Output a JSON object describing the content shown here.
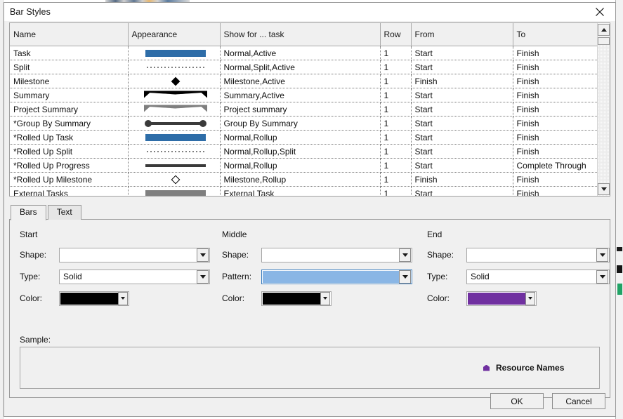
{
  "dialog": {
    "title": "Bar Styles",
    "close_icon": "close-icon"
  },
  "grid": {
    "columns": [
      "Name",
      "Appearance",
      "Show for ... task",
      "Row",
      "From",
      "To"
    ],
    "rows": [
      {
        "name": "Task",
        "appearance": "bar-blue",
        "show_for": "Normal,Active",
        "row": "1",
        "from": "Start",
        "to": "Finish"
      },
      {
        "name": "Split",
        "appearance": "dotted-line",
        "show_for": "Normal,Split,Active",
        "row": "1",
        "from": "Start",
        "to": "Finish"
      },
      {
        "name": "Milestone",
        "appearance": "diamond-solid",
        "show_for": "Milestone,Active",
        "row": "1",
        "from": "Finish",
        "to": "Finish"
      },
      {
        "name": "Summary",
        "appearance": "summary-black",
        "show_for": "Summary,Active",
        "row": "1",
        "from": "Start",
        "to": "Finish"
      },
      {
        "name": "Project Summary",
        "appearance": "summary-gray",
        "show_for": "Project summary",
        "row": "1",
        "from": "Start",
        "to": "Finish"
      },
      {
        "name": "*Group By Summary",
        "appearance": "groupby-bar",
        "show_for": "Group By Summary",
        "row": "1",
        "from": "Start",
        "to": "Finish"
      },
      {
        "name": "*Rolled Up Task",
        "appearance": "bar-blue",
        "show_for": "Normal,Rollup",
        "row": "1",
        "from": "Start",
        "to": "Finish"
      },
      {
        "name": "*Rolled Up Split",
        "appearance": "dotted-line",
        "show_for": "Normal,Rollup,Split",
        "row": "1",
        "from": "Start",
        "to": "Finish"
      },
      {
        "name": "*Rolled Up Progress",
        "appearance": "line-thick",
        "show_for": "Normal,Rollup",
        "row": "1",
        "from": "Start",
        "to": "Complete Through"
      },
      {
        "name": "*Rolled Up Milestone",
        "appearance": "diamond-hollow",
        "show_for": "Milestone,Rollup",
        "row": "1",
        "from": "Finish",
        "to": "Finish"
      },
      {
        "name": "External Tasks",
        "appearance": "bar-gray",
        "show_for": "External Task",
        "row": "1",
        "from": "Start",
        "to": "Finish"
      }
    ],
    "scrollbar": {
      "up_icon": "scroll-up-arrow-icon",
      "down_icon": "scroll-down-arrow-icon"
    }
  },
  "tabs": [
    {
      "label": "Bars",
      "active": true
    },
    {
      "label": "Text",
      "active": false
    }
  ],
  "bars_tab": {
    "start": {
      "title": "Start",
      "shape_label": "Shape:",
      "shape_value": "",
      "type_label": "Type:",
      "type_value": "Solid",
      "color_label": "Color:",
      "color_value": "#000000"
    },
    "middle": {
      "title": "Middle",
      "shape_label": "Shape:",
      "shape_value": "",
      "pattern_label": "Pattern:",
      "pattern_value": "",
      "pattern_color": "#8AB6E5",
      "color_label": "Color:",
      "color_value": "#000000"
    },
    "end": {
      "title": "End",
      "shape_label": "Shape:",
      "shape_value": "",
      "shape_glyph": "pentagon-up",
      "type_label": "Type:",
      "type_value": "Solid",
      "color_label": "Color:",
      "color_value": "#7030A0"
    },
    "sample": {
      "label": "Sample:",
      "marker_color": "#7030A0",
      "text": "Resource Names"
    }
  },
  "footer": {
    "ok_label": "OK",
    "cancel_label": "Cancel"
  },
  "colors": {
    "task_bar_blue": "#2E6DA8",
    "external_gray": "#7f7f7f",
    "accent_purple": "#7030A0",
    "pattern_blue": "#8AB6E5"
  }
}
